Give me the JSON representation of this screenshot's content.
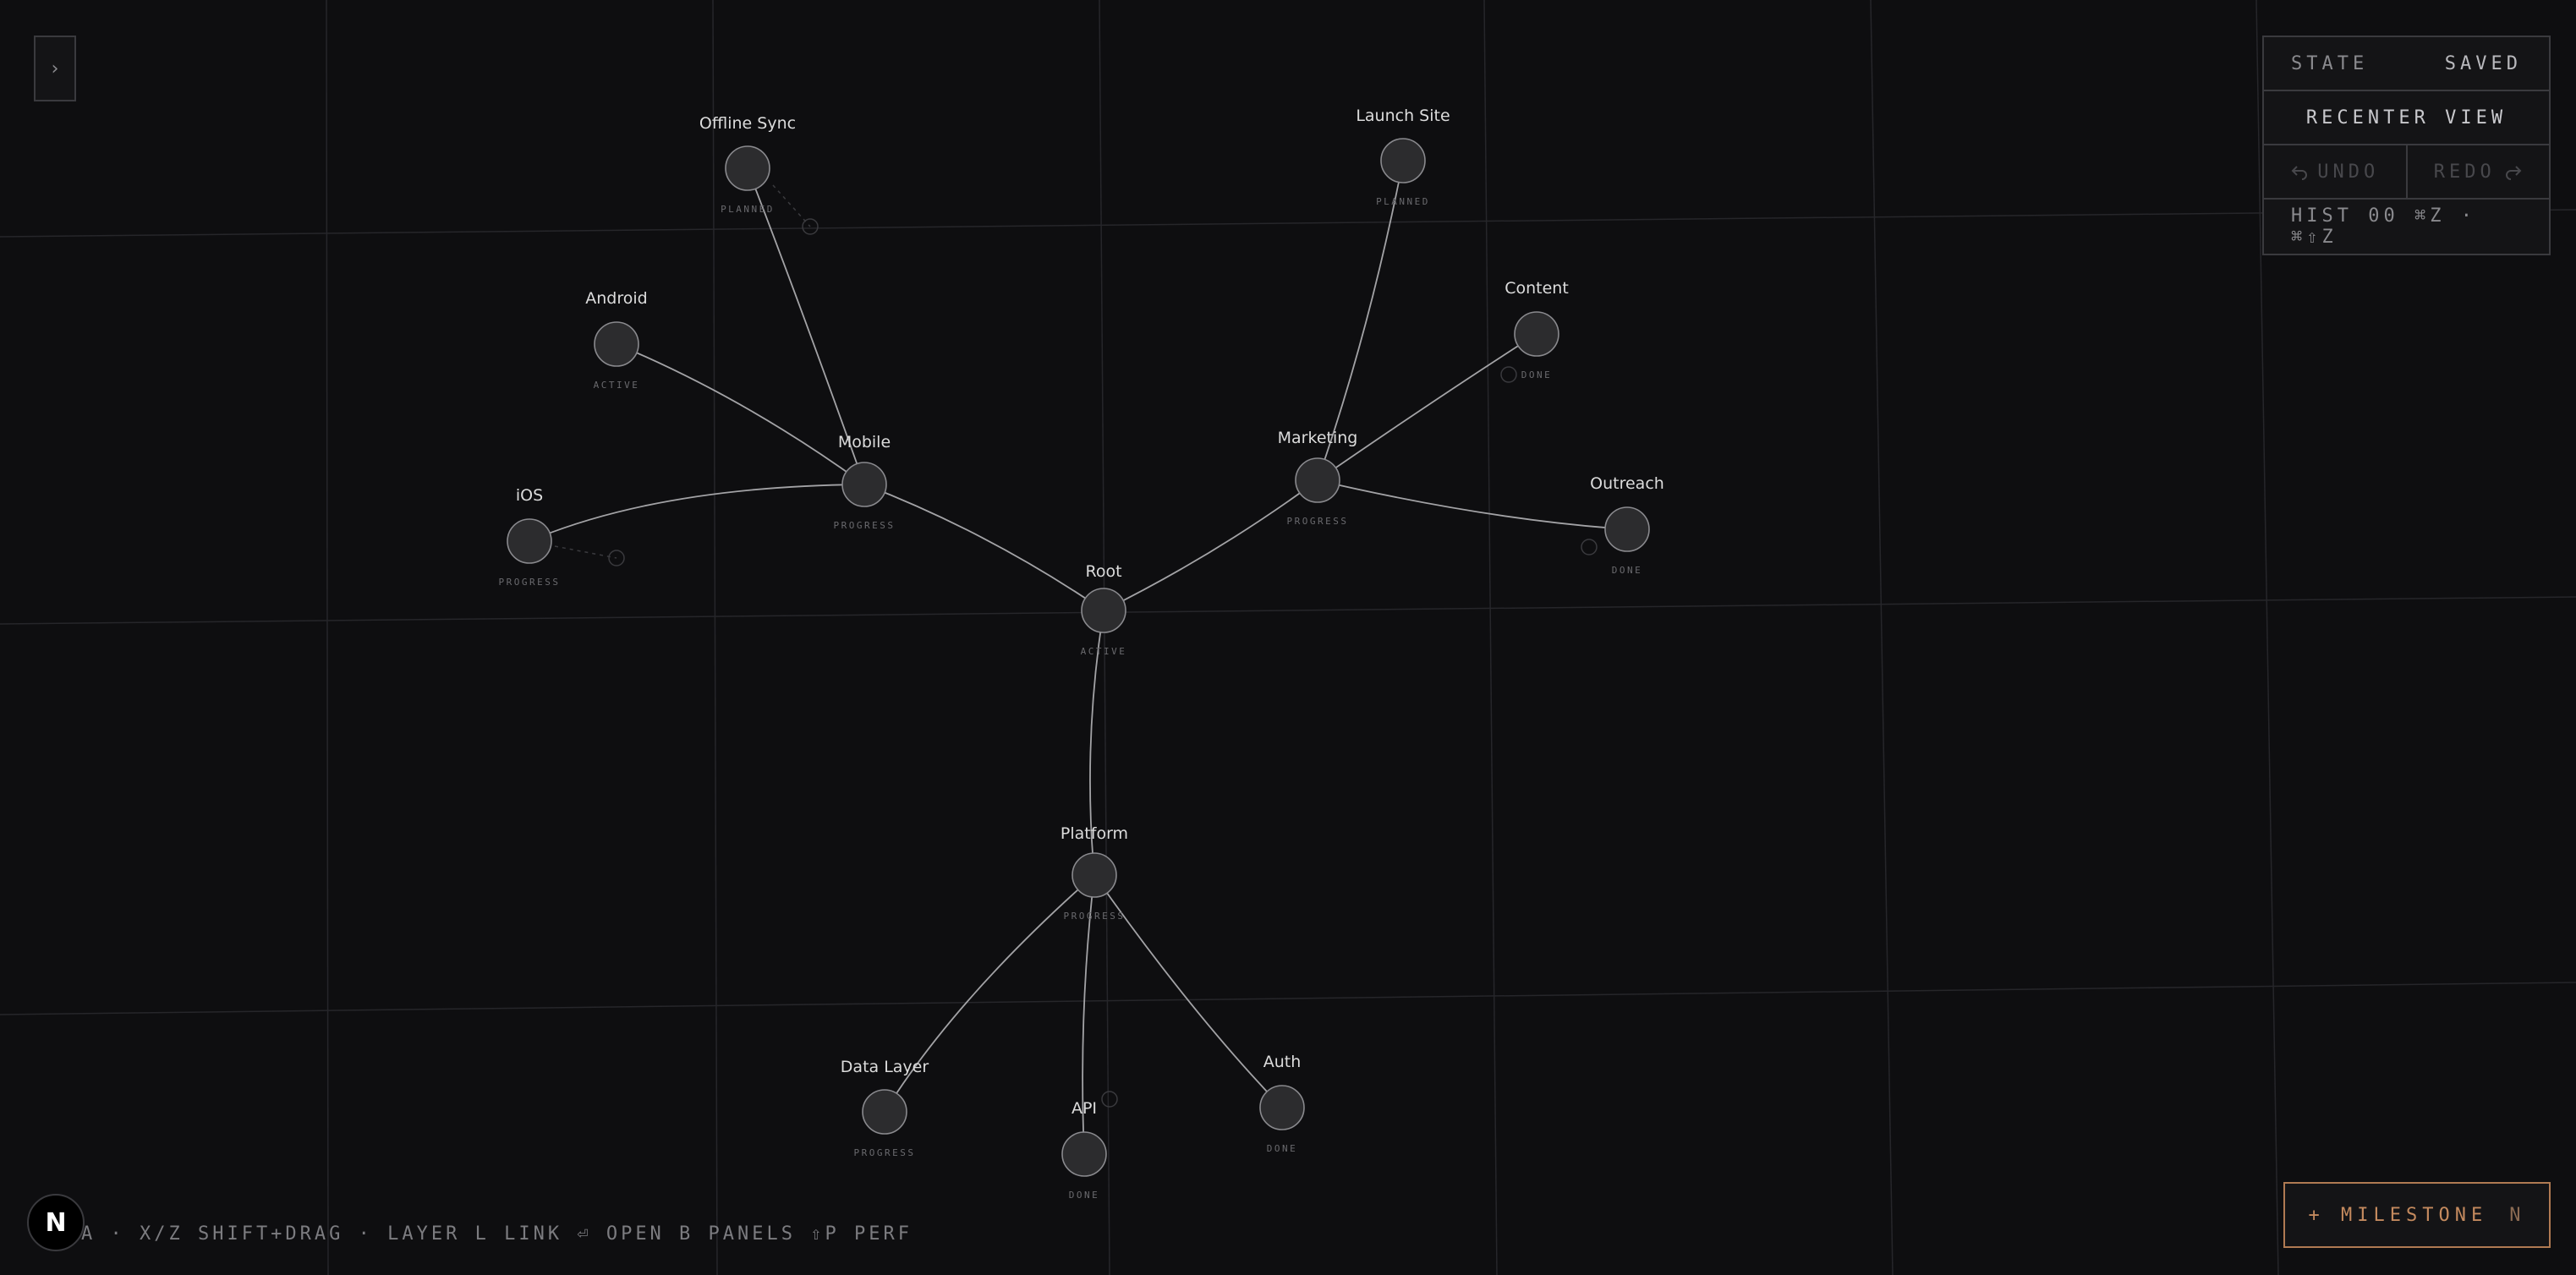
{
  "panel_toggle": {
    "icon": "chevron-right-icon",
    "glyph": "›"
  },
  "state_panel": {
    "state_label": "STATE",
    "state_value": "SAVED",
    "recenter_label": "RECENTER VIEW",
    "undo_label": "UNDO",
    "redo_label": "REDO",
    "undo_icon": "undo-icon",
    "redo_icon": "redo-icon",
    "history_text": "HIST 00 ⌘Z · ⌘⇧Z"
  },
  "milestone_button": {
    "label": "+ MILESTONE",
    "shortcut": "N"
  },
  "logo": {
    "letter": "N"
  },
  "hotkey_bar": {
    "text": "A · X/Z   SHIFT+DRAG · LAYER   L LINK   ⏎ OPEN   B PANELS   ⇧P PERF"
  },
  "colors": {
    "background": "#0e0e10",
    "accent": "#c48a5e",
    "edge": "#bdbdc1",
    "node_fill": "#2c2c2e",
    "node_stroke": "#8a8a8e",
    "grid": "#26262a"
  },
  "nodes": [
    {
      "id": "root",
      "label": "Root",
      "status": "ACTIVE"
    },
    {
      "id": "mobile",
      "label": "Mobile",
      "status": "PROGRESS"
    },
    {
      "id": "marketing",
      "label": "Marketing",
      "status": "PROGRESS"
    },
    {
      "id": "platform",
      "label": "Platform",
      "status": "PROGRESS"
    },
    {
      "id": "offline-sync",
      "label": "Offline Sync",
      "status": "PLANNED"
    },
    {
      "id": "android",
      "label": "Android",
      "status": "ACTIVE"
    },
    {
      "id": "ios",
      "label": "iOS",
      "status": "PROGRESS"
    },
    {
      "id": "launch-site",
      "label": "Launch Site",
      "status": "PLANNED"
    },
    {
      "id": "content",
      "label": "Content",
      "status": "DONE"
    },
    {
      "id": "outreach",
      "label": "Outreach",
      "status": "DONE"
    },
    {
      "id": "data-layer",
      "label": "Data Layer",
      "status": "PROGRESS"
    },
    {
      "id": "api",
      "label": "API",
      "status": "DONE"
    },
    {
      "id": "auth",
      "label": "Auth",
      "status": "DONE"
    }
  ],
  "edges": [
    [
      "root",
      "mobile"
    ],
    [
      "root",
      "marketing"
    ],
    [
      "root",
      "platform"
    ],
    [
      "mobile",
      "offline-sync"
    ],
    [
      "mobile",
      "android"
    ],
    [
      "mobile",
      "ios"
    ],
    [
      "marketing",
      "launch-site"
    ],
    [
      "marketing",
      "content"
    ],
    [
      "marketing",
      "outreach"
    ],
    [
      "platform",
      "data-layer"
    ],
    [
      "platform",
      "api"
    ],
    [
      "platform",
      "auth"
    ]
  ]
}
